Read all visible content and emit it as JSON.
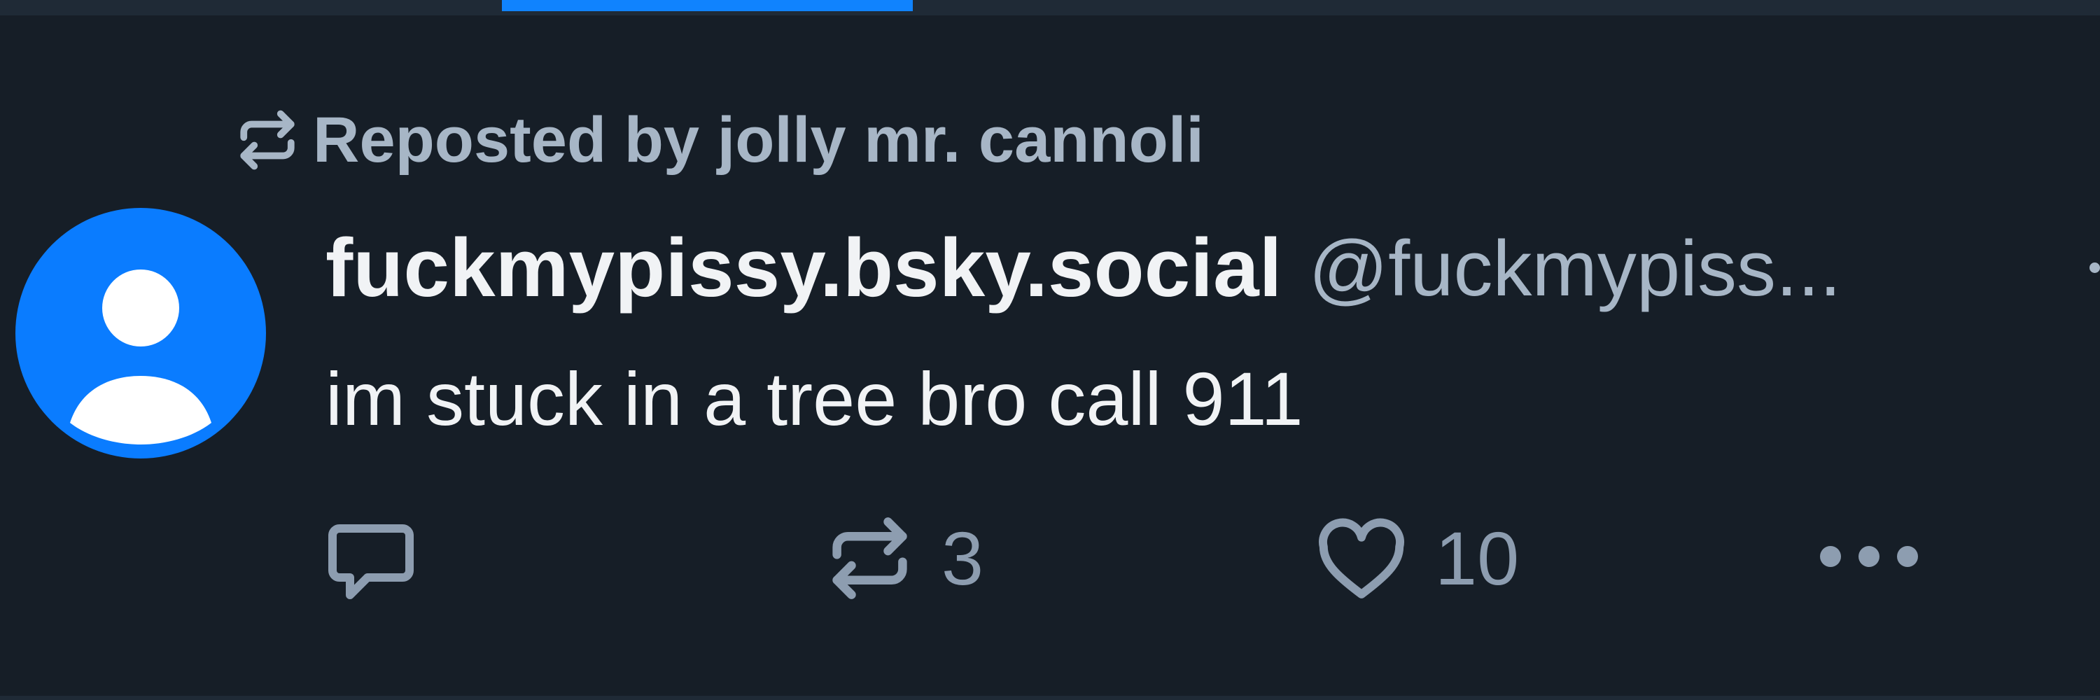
{
  "feed": {
    "active_tab_color": "#1083fe"
  },
  "post": {
    "repost_label": "Reposted by jolly mr. cannoli",
    "author": {
      "display_name": "fuckmypissy.bsky.social",
      "handle": "@fuckmypiss..."
    },
    "text": "im stuck in a tree bro call 911",
    "actions": {
      "reply_count": "",
      "repost_count": "3",
      "like_count": "10"
    }
  },
  "icons": {
    "repost": "repost-icon",
    "avatar": "default-avatar-icon",
    "reply": "reply-bubble-icon",
    "like": "heart-icon",
    "more": "ellipsis-icon"
  },
  "colors": {
    "background": "#161e27",
    "avatar": "#0a7cff",
    "muted_text": "#a7b6c6",
    "primary_text": "#f1f3f5"
  }
}
